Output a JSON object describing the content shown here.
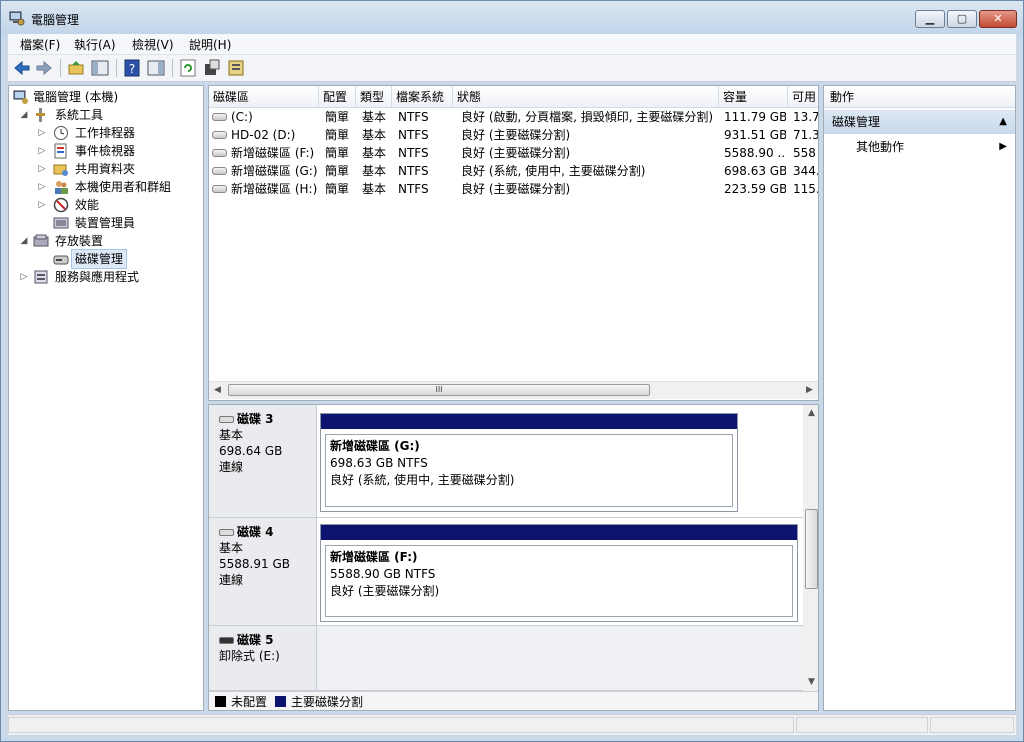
{
  "window": {
    "title": "電腦管理"
  },
  "menu": [
    "檔案(F)",
    "執行(A)",
    "檢視(V)",
    "說明(H)"
  ],
  "toolbar": {
    "icons": [
      "back-icon",
      "forward-icon",
      "up-folder-icon",
      "show-hide-tree-icon",
      "help-icon",
      "show-hide-action-icon",
      "refresh-icon",
      "properties-icon",
      "export-icon"
    ]
  },
  "tree": {
    "root": "電腦管理 (本機)",
    "system_tools": "系統工具",
    "task_scheduler": "工作排程器",
    "event_viewer": "事件檢視器",
    "shared_folders": "共用資料夾",
    "local_users": "本機使用者和群組",
    "performance": "效能",
    "device_manager": "裝置管理員",
    "storage": "存放裝置",
    "disk_management": "磁碟管理",
    "services_apps": "服務與應用程式"
  },
  "volume_list": {
    "columns": [
      "磁碟區",
      "配置",
      "類型",
      "檔案系統",
      "狀態",
      "容量",
      "可用"
    ],
    "rows": [
      {
        "volume": "(C:)",
        "layout": "簡單",
        "type": "基本",
        "fs": "NTFS",
        "status": "良好 (啟動, 分頁檔案, 損毀傾印, 主要磁碟分割)",
        "capacity": "111.79 GB",
        "free": "13.7"
      },
      {
        "volume": "HD-02 (D:)",
        "layout": "簡單",
        "type": "基本",
        "fs": "NTFS",
        "status": "良好 (主要磁碟分割)",
        "capacity": "931.51 GB",
        "free": "71.3"
      },
      {
        "volume": "新增磁碟區 (F:)",
        "layout": "簡單",
        "type": "基本",
        "fs": "NTFS",
        "status": "良好 (主要磁碟分割)",
        "capacity": "5588.90 ...",
        "free": "558"
      },
      {
        "volume": "新增磁碟區 (G:)",
        "layout": "簡單",
        "type": "基本",
        "fs": "NTFS",
        "status": "良好 (系統, 使用中, 主要磁碟分割)",
        "capacity": "698.63 GB",
        "free": "344."
      },
      {
        "volume": "新增磁碟區 (H:)",
        "layout": "簡單",
        "type": "基本",
        "fs": "NTFS",
        "status": "良好 (主要磁碟分割)",
        "capacity": "223.59 GB",
        "free": "115."
      }
    ],
    "scroll_grip": "III"
  },
  "disks": [
    {
      "name": "磁碟 3",
      "kind": "基本",
      "size": "698.64 GB",
      "state": "連線",
      "partition": {
        "name": "新增磁碟區 (G:)",
        "size": "698.63 GB NTFS",
        "status": "良好 (系統, 使用中, 主要磁碟分割)"
      }
    },
    {
      "name": "磁碟 4",
      "kind": "基本",
      "size": "5588.91 GB",
      "state": "連線",
      "partition": {
        "name": "新增磁碟區 (F:)",
        "size": "5588.90 GB NTFS",
        "status": "良好 (主要磁碟分割)"
      }
    },
    {
      "name": "磁碟 5",
      "kind": "卸除式 (E:)",
      "size": "",
      "state": "",
      "partition": null
    }
  ],
  "legend": {
    "unallocated": "未配置",
    "primary": "主要磁碟分割",
    "unallocated_color": "#000000",
    "primary_color": "#0d1470"
  },
  "actions": {
    "title": "動作",
    "section": "磁碟管理",
    "more": "其他動作"
  }
}
